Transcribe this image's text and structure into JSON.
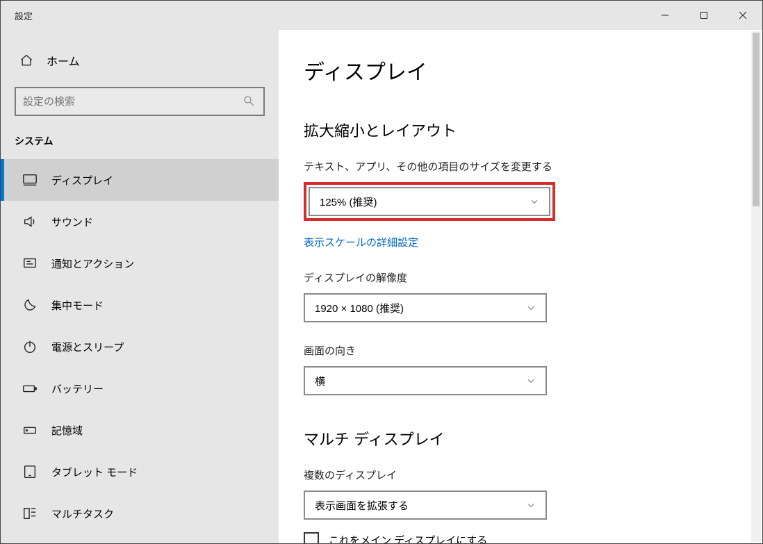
{
  "window": {
    "title": "設定"
  },
  "home": {
    "label": "ホーム"
  },
  "search": {
    "placeholder": "設定の検索"
  },
  "section_label": "システム",
  "nav": {
    "items": [
      {
        "label": "ディスプレイ",
        "active": true
      },
      {
        "label": "サウンド"
      },
      {
        "label": "通知とアクション"
      },
      {
        "label": "集中モード"
      },
      {
        "label": "電源とスリープ"
      },
      {
        "label": "バッテリー"
      },
      {
        "label": "記憶域"
      },
      {
        "label": "タブレット モード"
      },
      {
        "label": "マルチタスク"
      }
    ]
  },
  "page": {
    "title": "ディスプレイ",
    "section1": {
      "heading": "拡大縮小とレイアウト",
      "scale_label": "テキスト、アプリ、その他の項目のサイズを変更する",
      "scale_value": "125% (推奨)",
      "advanced_link": "表示スケールの詳細設定",
      "resolution_label": "ディスプレイの解像度",
      "resolution_value": "1920 × 1080 (推奨)",
      "orientation_label": "画面の向き",
      "orientation_value": "横"
    },
    "section2": {
      "heading": "マルチ ディスプレイ",
      "multi_label": "複数のディスプレイ",
      "multi_value": "表示画面を拡張する",
      "checkbox_label": "これをメイン ディスプレイにする"
    }
  }
}
